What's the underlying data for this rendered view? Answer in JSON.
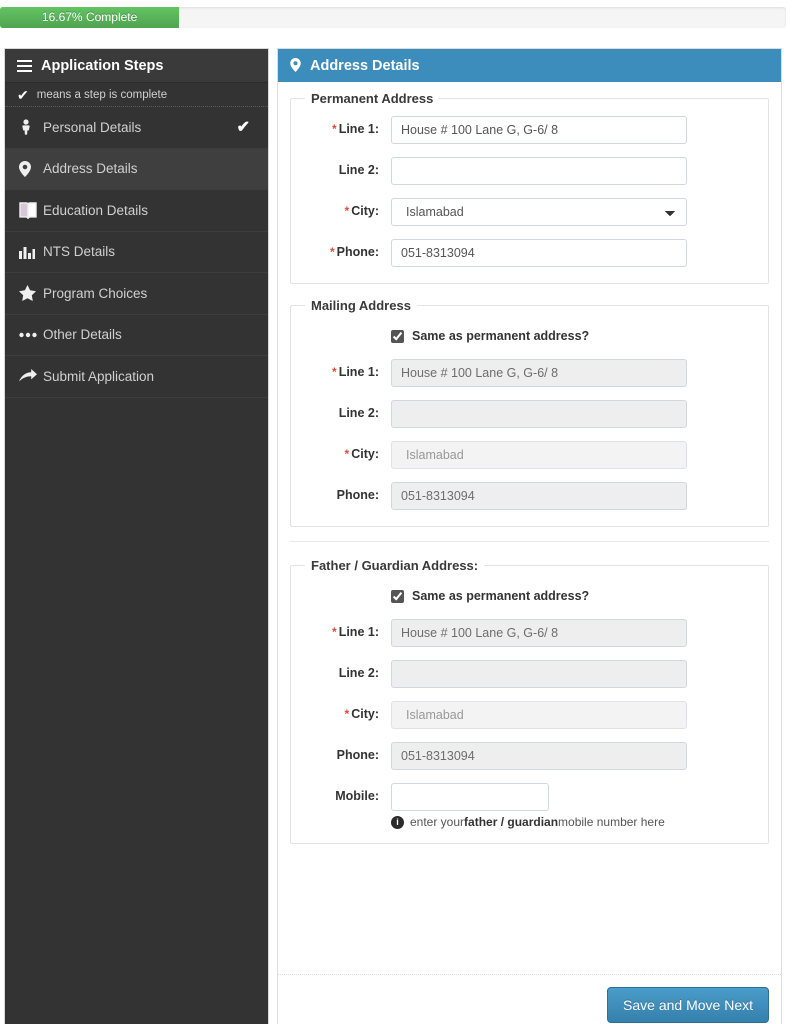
{
  "progress": {
    "label": "16.67% Complete",
    "percent": 16.67,
    "fill_color": "#5cb85c",
    "track_color": "#f5f5f5"
  },
  "sidebar": {
    "title": "Application Steps",
    "legend": "means a step is complete",
    "legend_icon": "check-icon",
    "items": [
      {
        "label": "Personal Details",
        "icon": "person-icon",
        "complete_mark": "✔",
        "active": false
      },
      {
        "label": "Address Details",
        "icon": "map-marker-icon",
        "complete_mark": "",
        "active": true
      },
      {
        "label": "Education Details",
        "icon": "book-icon",
        "complete_mark": "",
        "active": false
      },
      {
        "label": "NTS Details",
        "icon": "bar-chart-icon",
        "complete_mark": "",
        "active": false
      },
      {
        "label": "Program Choices",
        "icon": "star-icon",
        "complete_mark": "",
        "active": false
      },
      {
        "label": "Other Details",
        "icon": "ellipsis-icon",
        "complete_mark": "",
        "active": false
      },
      {
        "label": "Submit Application",
        "icon": "arrow-icon",
        "complete_mark": "",
        "active": false
      }
    ]
  },
  "panel": {
    "title": "Address Details",
    "title_icon": "map-marker-icon",
    "header_color": "#3c8dbc"
  },
  "permanent": {
    "legend": "Permanent Address",
    "line1_label": "Line 1:",
    "line1_value": "House # 100 Lane G, G-6/ 8",
    "line2_label": "Line 2:",
    "line2_value": "",
    "city_label": "City:",
    "city_value": "Islamabad",
    "phone_label": "Phone:",
    "phone_value": "051-8313094"
  },
  "mailing": {
    "legend": "Mailing Address",
    "same_as_label": "Same as permanent address?",
    "same_as_checked": true,
    "line1_label": "Line 1:",
    "line1_value": "House # 100 Lane G, G-6/ 8",
    "line2_label": "Line 2:",
    "line2_value": "",
    "city_label": "City:",
    "city_value": "Islamabad",
    "phone_label": "Phone:",
    "phone_value": "051-8313094"
  },
  "guardian": {
    "legend": "Father / Guardian Address:",
    "same_as_label": "Same as permanent address?",
    "same_as_checked": true,
    "line1_label": "Line 1:",
    "line1_value": "House # 100 Lane G, G-6/ 8",
    "line2_label": "Line 2:",
    "line2_value": "",
    "city_label": "City:",
    "city_value": "Islamabad",
    "phone_label": "Phone:",
    "phone_value": "051-8313094",
    "mobile_label": "Mobile:",
    "mobile_value": "",
    "hint_prefix": "enter your ",
    "hint_bold": "father / guardian",
    "hint_suffix": " mobile number here"
  },
  "footer": {
    "save_label": "Save and Move Next"
  }
}
